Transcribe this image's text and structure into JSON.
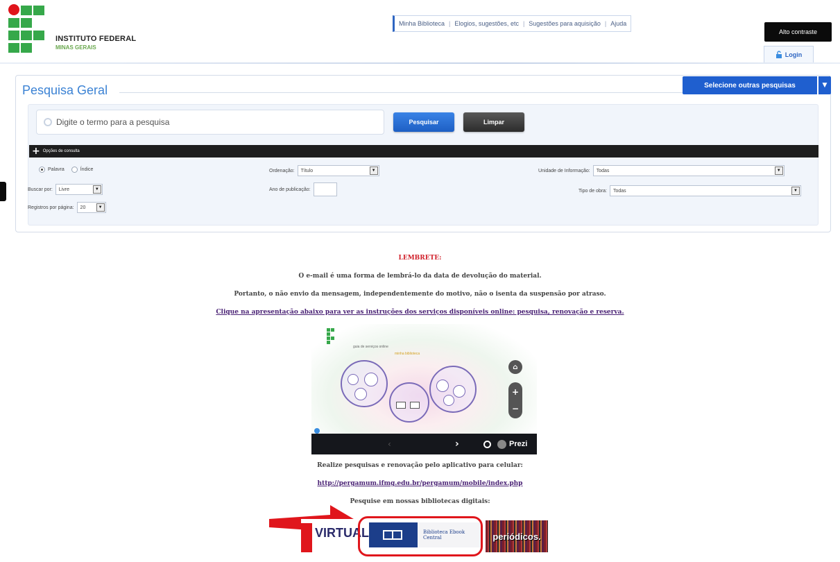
{
  "header": {
    "institution_name": "INSTITUTO FEDERAL",
    "institution_sub": "MINAS GERAIS",
    "nav": [
      "Minha Biblioteca",
      "Elogios, sugestões, etc",
      "Sugestões para aquisição",
      "Ajuda"
    ],
    "contrast_label": "Alto contraste",
    "login_label": "Login"
  },
  "search": {
    "title": "Pesquisa Geral",
    "other_searches_label": "Selecione outras pesquisas",
    "placeholder": "Digite o termo para a pesquisa",
    "search_button": "Pesquisar",
    "clear_button": "Limpar",
    "options_label": "Opções de consulta",
    "radio_palavra": "Palavra",
    "radio_indice": "Índice",
    "buscar_por_label": "Buscar por:",
    "buscar_por_value": "Livre",
    "registros_label": "Registros por página:",
    "registros_value": "20",
    "ordenacao_label": "Ordenação:",
    "ordenacao_value": "Título",
    "ano_label": "Ano de publicação:",
    "unidade_label": "Unidade de Informação:",
    "unidade_value": "Todas",
    "tipo_label": "Tipo de obra:",
    "tipo_value": "Todas"
  },
  "content": {
    "reminder_title": "LEMBRETE:",
    "reminder_line1": "O e-mail é uma forma de lembrá-lo da data de devolução do material.",
    "reminder_line2": "Portanto, o não envio da mensagem, independentemente do motivo, não o isenta da suspensão por atraso.",
    "presentation_link": "Clique na apresentação abaixo para ver as instruções dos serviços disponíveis online: pesquisa, renovação e reserva.",
    "app_text": "Realize pesquisas e renovação pelo aplicativo para celular:",
    "app_link": "http://pergamum.ifmg.edu.br/pergamum/mobile/index.php",
    "digital_text": "Pesquise em nossas bibliotecas digitais:"
  },
  "prezi": {
    "player_label": "Prezi",
    "slide_title": "guia de serviços online",
    "slide_subtitle": "minha biblioteca"
  },
  "digital_libraries": {
    "virtual_label": "VIRTUAL",
    "pearson_label": "Biblioteca Ebook Central",
    "periodicos_label": "periódicos."
  },
  "colors": {
    "accent_blue": "#1f5fcf",
    "title_blue": "#3b82d4",
    "reminder_red": "#d0202a",
    "highlight_red": "#e0161c"
  }
}
